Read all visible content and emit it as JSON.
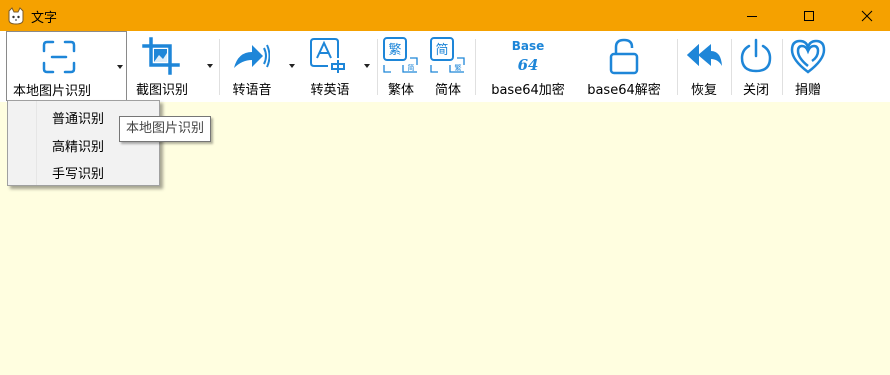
{
  "window": {
    "title": "文字",
    "accent_color": "#F5A100",
    "body_color": "#FFFEE0"
  },
  "toolbar": {
    "icon_color": "#1E86D8",
    "buttons": [
      {
        "label": "本地图片识别",
        "icon": "scan-frame-icon",
        "has_dropdown": true,
        "pressed": true
      },
      {
        "label": "截图识别",
        "icon": "crop-icon",
        "has_dropdown": true
      },
      {
        "label": "转语音",
        "icon": "speech-arrow-icon",
        "has_dropdown": true
      },
      {
        "label": "转英语",
        "icon": "translate-icon",
        "has_dropdown": true
      },
      {
        "label": "繁体",
        "icon": "traditional-chinese-icon",
        "glyph_main": "繁",
        "glyph_sub": "简"
      },
      {
        "label": "简体",
        "icon": "simplified-chinese-icon",
        "glyph_main": "简",
        "glyph_sub": "繁"
      },
      {
        "label": "base64加密",
        "icon": "base64-icon",
        "glyph_top": "Base",
        "glyph_bottom": "64"
      },
      {
        "label": "base64解密",
        "icon": "unlock-icon"
      },
      {
        "label": "恢复",
        "icon": "reply-all-icon"
      },
      {
        "label": "关闭",
        "icon": "power-icon"
      },
      {
        "label": "捐赠",
        "icon": "heart-icon"
      }
    ]
  },
  "dropdown_menu": {
    "items": [
      "普通识别",
      "高精识别",
      "手写识别"
    ]
  },
  "tooltip": {
    "text": "本地图片识别"
  }
}
